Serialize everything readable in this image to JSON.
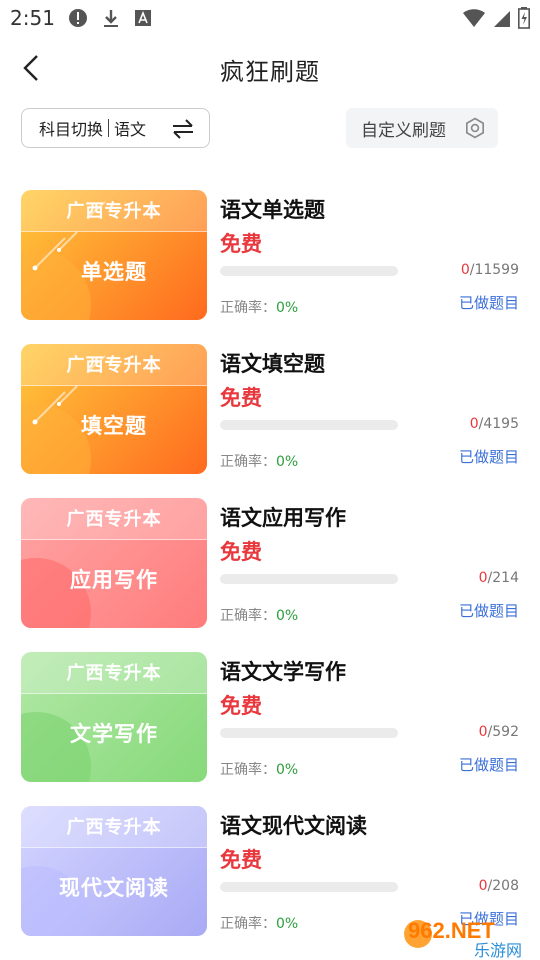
{
  "status_bar": {
    "time": "2:51",
    "left_icons": [
      "alert-icon",
      "download-icon",
      "font-icon"
    ],
    "right_icons": [
      "wifi-icon",
      "signal-icon",
      "battery-icon"
    ]
  },
  "header": {
    "title": "疯狂刷题",
    "back_icon": "chevron-left-icon"
  },
  "toolbar": {
    "switch_prefix": "科目切换",
    "switch_subject": "语文",
    "switch_icon": "swap-arrows-icon",
    "custom_label": "自定义刷题",
    "custom_icon": "gear-icon"
  },
  "items": [
    {
      "card_tag": "广西专升本",
      "card_name": "单选题",
      "title": "语文单选题",
      "price": "免费",
      "done_count": "0",
      "total": "/11599",
      "progress": 0,
      "accuracy_label": "正确率：",
      "accuracy_value": "0%",
      "done_link": "已做题目",
      "theme": "orange"
    },
    {
      "card_tag": "广西专升本",
      "card_name": "填空题",
      "title": "语文填空题",
      "price": "免费",
      "done_count": "0",
      "total": "/4195",
      "progress": 0,
      "accuracy_label": "正确率：",
      "accuracy_value": "0%",
      "done_link": "已做题目",
      "theme": "orange"
    },
    {
      "card_tag": "广西专升本",
      "card_name": "应用写作",
      "title": "语文应用写作",
      "price": "免费",
      "done_count": "0",
      "total": "/214",
      "progress": 0,
      "accuracy_label": "正确率：",
      "accuracy_value": "0%",
      "done_link": "已做题目",
      "theme": "red"
    },
    {
      "card_tag": "广西专升本",
      "card_name": "文学写作",
      "title": "语文文学写作",
      "price": "免费",
      "done_count": "0",
      "total": "/592",
      "progress": 0,
      "accuracy_label": "正确率：",
      "accuracy_value": "0%",
      "done_link": "已做题目",
      "theme": "green"
    },
    {
      "card_tag": "广西专升本",
      "card_name": "现代文阅读",
      "title": "语文现代文阅读",
      "price": "免费",
      "done_count": "0",
      "total": "/208",
      "progress": 0,
      "accuracy_label": "正确率：",
      "accuracy_value": "0%",
      "done_link": "已做题目",
      "theme": "purple"
    }
  ],
  "themes": {
    "orange": {
      "from": "#ffc93c",
      "to": "#ff6a1e",
      "blob": "#ffb13a"
    },
    "red": {
      "from": "#ffa4a4",
      "to": "#ff7c7c",
      "blob": "#ff6767"
    },
    "green": {
      "from": "#b2e8a6",
      "to": "#86d97a",
      "blob": "#79d26b"
    },
    "purple": {
      "from": "#d4d5ff",
      "to": "#a9aaf5",
      "blob": "#b9bbff"
    }
  },
  "colors": {
    "accent_red": "#e8383d",
    "link_blue": "#3a6fd8",
    "accuracy_green": "#2e9e3e"
  },
  "watermark": {
    "brand": "962.NET",
    "sub": "乐游网"
  }
}
